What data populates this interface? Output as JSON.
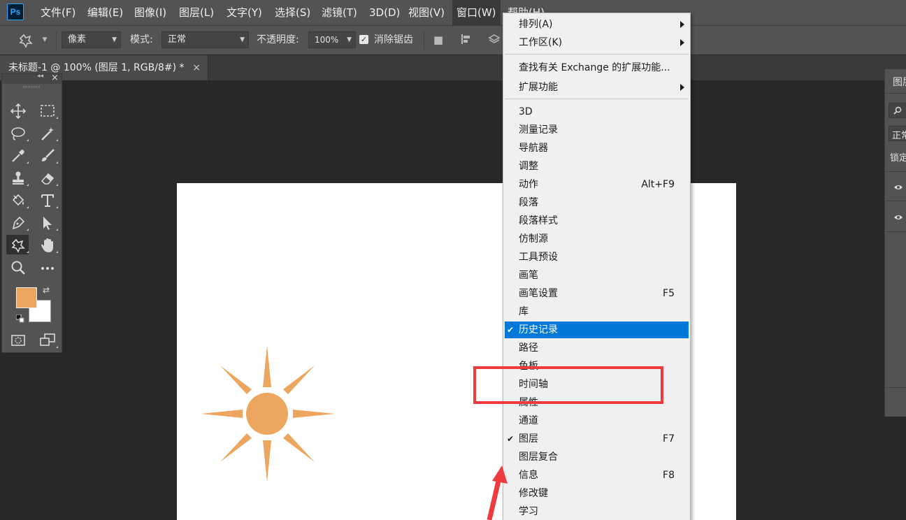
{
  "app": {
    "logo_text": "Ps"
  },
  "menubar": {
    "items": [
      {
        "label": "文件(F)"
      },
      {
        "label": "编辑(E)"
      },
      {
        "label": "图像(I)"
      },
      {
        "label": "图层(L)"
      },
      {
        "label": "文字(Y)"
      },
      {
        "label": "选择(S)"
      },
      {
        "label": "滤镜(T)"
      },
      {
        "label": "3D(D)"
      },
      {
        "label": "视图(V)"
      },
      {
        "label": "窗口(W)"
      },
      {
        "label": "帮助(H)"
      }
    ]
  },
  "options_bar": {
    "source_select": "像素",
    "mode_label": "模式:",
    "mode_value": "正常",
    "opacity_label": "不透明度:",
    "opacity_value": "100%",
    "antialias_label": "消除锯齿",
    "antialias_checked": true
  },
  "document_tab": {
    "title": "未标题-1 @ 100% (图层 1, RGB/8#) *",
    "close": "×"
  },
  "tools_panel": {
    "close": "×",
    "collapse": "◂◂",
    "foreground_color": "#eca65f",
    "background_color": "#ffffff",
    "tools": [
      "move-tool-icon",
      "marquee-tool-icon",
      "lasso-tool-icon",
      "magic-wand-tool-icon",
      "eyedropper-tool-icon",
      "brush-tool-icon",
      "stamp-tool-icon",
      "eraser-tool-icon",
      "paint-bucket-tool-icon",
      "type-tool-icon",
      "pen-tool-icon",
      "path-select-tool-icon",
      "custom-shape-tool-icon",
      "hand-tool-icon",
      "zoom-tool-icon",
      "more-tools-icon",
      "quick-mask-icon",
      "screen-mode-icon"
    ]
  },
  "canvas": {
    "shape": "sun",
    "shape_color": "#eca65f"
  },
  "right_panel": {
    "title": "图层",
    "blend": "正常",
    "lock_label": "锁定"
  },
  "window_menu": {
    "items": [
      {
        "label": "排列(A)",
        "submenu": true
      },
      {
        "label": "工作区(K)",
        "submenu": true
      },
      {
        "label": "查找有关 Exchange 的扩展功能..."
      },
      {
        "label": "扩展功能",
        "submenu": true
      },
      {
        "label": "3D"
      },
      {
        "label": "测量记录"
      },
      {
        "label": "导航器"
      },
      {
        "label": "调整"
      },
      {
        "label": "动作",
        "shortcut": "Alt+F9"
      },
      {
        "label": "段落"
      },
      {
        "label": "段落样式"
      },
      {
        "label": "仿制源"
      },
      {
        "label": "工具预设"
      },
      {
        "label": "画笔"
      },
      {
        "label": "画笔设置",
        "shortcut": "F5"
      },
      {
        "label": "库"
      },
      {
        "label": "历史记录",
        "checked": true,
        "highlighted": true
      },
      {
        "label": "路径"
      },
      {
        "label": "色板"
      },
      {
        "label": "时间轴"
      },
      {
        "label": "属性"
      },
      {
        "label": "通道"
      },
      {
        "label": "图层",
        "shortcut": "F7",
        "checked": true
      },
      {
        "label": "图层复合"
      },
      {
        "label": "信息",
        "shortcut": "F8"
      },
      {
        "label": "修改键"
      },
      {
        "label": "学习"
      }
    ]
  },
  "annotation": {
    "color": "#ee3b3f",
    "highlighted_item": "时间轴"
  }
}
